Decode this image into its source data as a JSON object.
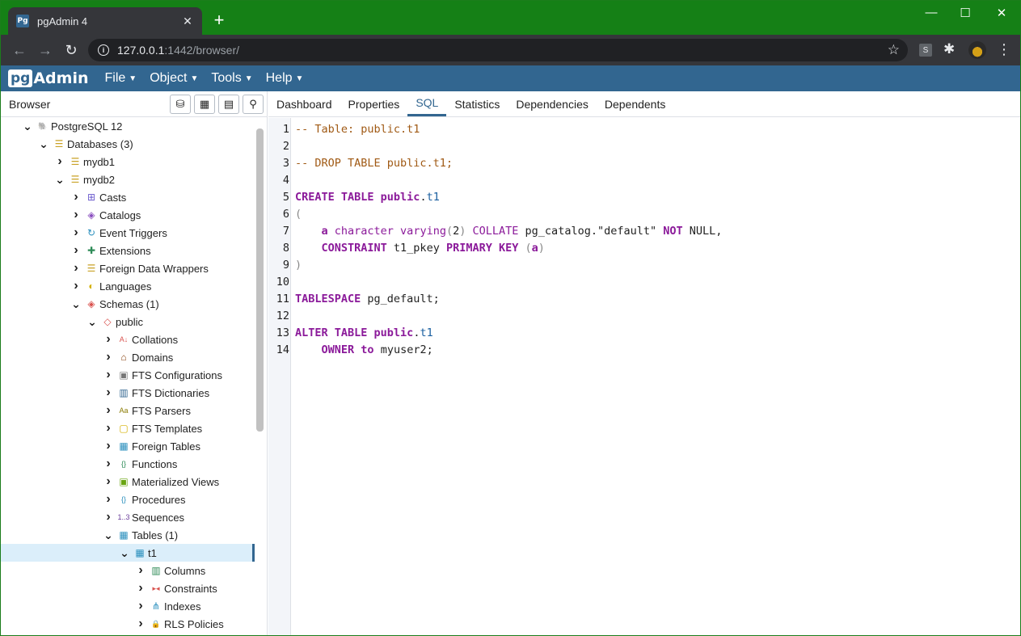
{
  "browser": {
    "tab_title": "pgAdmin 4",
    "tab_favicon": "Pg",
    "url_host": "127.0.0.1",
    "url_path": ":1442/browser/",
    "ext_label": "S"
  },
  "pgadmin": {
    "logo_pg": "pg",
    "logo_admin": "Admin",
    "menu": [
      "File",
      "Object",
      "Tools",
      "Help"
    ]
  },
  "browser_panel": {
    "title": "Browser"
  },
  "tree": [
    {
      "depth": 0,
      "expanded": true,
      "label": "PostgreSQL 12",
      "icon": "server-icon",
      "glyph": "🐘",
      "color": "#326690"
    },
    {
      "depth": 1,
      "expanded": true,
      "label": "Databases (3)",
      "icon": "databases-icon",
      "glyph": "☰",
      "color": "#c9a227"
    },
    {
      "depth": 2,
      "expanded": false,
      "label": "mydb1",
      "icon": "database-icon",
      "glyph": "☰",
      "color": "#c9a227"
    },
    {
      "depth": 2,
      "expanded": true,
      "label": "mydb2",
      "icon": "database-icon",
      "glyph": "☰",
      "color": "#c9a227"
    },
    {
      "depth": 3,
      "expanded": false,
      "label": "Casts",
      "icon": "casts-icon",
      "glyph": "⊞",
      "color": "#6a5acd"
    },
    {
      "depth": 3,
      "expanded": false,
      "label": "Catalogs",
      "icon": "catalogs-icon",
      "glyph": "◈",
      "color": "#8a4fbf"
    },
    {
      "depth": 3,
      "expanded": false,
      "label": "Event Triggers",
      "icon": "event-triggers-icon",
      "glyph": "↻",
      "color": "#2a8fbd"
    },
    {
      "depth": 3,
      "expanded": false,
      "label": "Extensions",
      "icon": "extensions-icon",
      "glyph": "✚",
      "color": "#2e8b57"
    },
    {
      "depth": 3,
      "expanded": false,
      "label": "Foreign Data Wrappers",
      "icon": "fdw-icon",
      "glyph": "☰",
      "color": "#c9a227"
    },
    {
      "depth": 3,
      "expanded": false,
      "label": "Languages",
      "icon": "languages-icon",
      "glyph": "◐",
      "color": "#d4b000"
    },
    {
      "depth": 3,
      "expanded": true,
      "label": "Schemas (1)",
      "icon": "schemas-icon",
      "glyph": "◈",
      "color": "#d9534f"
    },
    {
      "depth": 4,
      "expanded": true,
      "label": "public",
      "icon": "schema-icon",
      "glyph": "◇",
      "color": "#d9534f"
    },
    {
      "depth": 5,
      "expanded": false,
      "label": "Collations",
      "icon": "collations-icon",
      "glyph": "A↓",
      "color": "#d9534f"
    },
    {
      "depth": 5,
      "expanded": false,
      "label": "Domains",
      "icon": "domains-icon",
      "glyph": "⌂",
      "color": "#8b4513"
    },
    {
      "depth": 5,
      "expanded": false,
      "label": "FTS Configurations",
      "icon": "fts-configurations-icon",
      "glyph": "▣",
      "color": "#777"
    },
    {
      "depth": 5,
      "expanded": false,
      "label": "FTS Dictionaries",
      "icon": "fts-dictionaries-icon",
      "glyph": "▥",
      "color": "#336791"
    },
    {
      "depth": 5,
      "expanded": false,
      "label": "FTS Parsers",
      "icon": "fts-parsers-icon",
      "glyph": "Aa",
      "color": "#8a7a00"
    },
    {
      "depth": 5,
      "expanded": false,
      "label": "FTS Templates",
      "icon": "fts-templates-icon",
      "glyph": "▢",
      "color": "#d4b000"
    },
    {
      "depth": 5,
      "expanded": false,
      "label": "Foreign Tables",
      "icon": "foreign-tables-icon",
      "glyph": "▦",
      "color": "#2a8fbd"
    },
    {
      "depth": 5,
      "expanded": false,
      "label": "Functions",
      "icon": "functions-icon",
      "glyph": "{}",
      "color": "#2e8b57"
    },
    {
      "depth": 5,
      "expanded": false,
      "label": "Materialized Views",
      "icon": "materialized-views-icon",
      "glyph": "▣",
      "color": "#6aa512"
    },
    {
      "depth": 5,
      "expanded": false,
      "label": "Procedures",
      "icon": "procedures-icon",
      "glyph": "{}",
      "color": "#2a8fbd"
    },
    {
      "depth": 5,
      "expanded": false,
      "label": "Sequences",
      "icon": "sequences-icon",
      "glyph": "1..3",
      "color": "#6a3d9a"
    },
    {
      "depth": 5,
      "expanded": true,
      "label": "Tables (1)",
      "icon": "tables-icon",
      "glyph": "▦",
      "color": "#2a8fbd"
    },
    {
      "depth": 6,
      "expanded": true,
      "label": "t1",
      "icon": "table-icon",
      "glyph": "▦",
      "color": "#2a8fbd",
      "selected": true
    },
    {
      "depth": 7,
      "expanded": false,
      "label": "Columns",
      "icon": "columns-icon",
      "glyph": "▥",
      "color": "#2e8b57"
    },
    {
      "depth": 7,
      "expanded": false,
      "label": "Constraints",
      "icon": "constraints-icon",
      "glyph": "▸◂",
      "color": "#d9534f"
    },
    {
      "depth": 7,
      "expanded": false,
      "label": "Indexes",
      "icon": "indexes-icon",
      "glyph": "⋔",
      "color": "#2a8fbd"
    },
    {
      "depth": 7,
      "expanded": false,
      "label": "RLS Policies",
      "icon": "rls-policies-icon",
      "glyph": "🔒",
      "color": "#2e8b57"
    }
  ],
  "right_tabs": [
    "Dashboard",
    "Properties",
    "SQL",
    "Statistics",
    "Dependencies",
    "Dependents"
  ],
  "active_tab": "SQL",
  "sql_lines": [
    [
      [
        "cm-comment",
        "-- Table: public.t1"
      ]
    ],
    [],
    [
      [
        "cm-comment",
        "-- DROP TABLE public.t1;"
      ]
    ],
    [],
    [
      [
        "cm-keyword",
        "CREATE TABLE "
      ],
      [
        "cm-keyword",
        "public"
      ],
      [
        "cm-plain",
        "."
      ],
      [
        "cm-def",
        "t1"
      ]
    ],
    [
      [
        "cm-punct",
        "("
      ]
    ],
    [
      [
        "cm-plain",
        "    "
      ],
      [
        "cm-keyword",
        "a "
      ],
      [
        "cm-type",
        "character varying"
      ],
      [
        "cm-punct",
        "("
      ],
      [
        "cm-plain",
        "2"
      ],
      [
        "cm-punct",
        ")"
      ],
      [
        "cm-plain",
        " "
      ],
      [
        "cm-type",
        "COLLATE"
      ],
      [
        "cm-plain",
        " pg_catalog.\"default\" "
      ],
      [
        "cm-keyword",
        "NOT"
      ],
      [
        "cm-plain",
        " NULL,"
      ]
    ],
    [
      [
        "cm-plain",
        "    "
      ],
      [
        "cm-keyword",
        "CONSTRAINT"
      ],
      [
        "cm-plain",
        " t1_pkey "
      ],
      [
        "cm-keyword",
        "PRIMARY KEY"
      ],
      [
        "cm-plain",
        " "
      ],
      [
        "cm-punct",
        "("
      ],
      [
        "cm-keyword",
        "a"
      ],
      [
        "cm-punct",
        ")"
      ]
    ],
    [
      [
        "cm-punct",
        ")"
      ]
    ],
    [],
    [
      [
        "cm-keyword",
        "TABLESPACE"
      ],
      [
        "cm-plain",
        " pg_default;"
      ]
    ],
    [],
    [
      [
        "cm-keyword",
        "ALTER TABLE "
      ],
      [
        "cm-keyword",
        "public"
      ],
      [
        "cm-plain",
        "."
      ],
      [
        "cm-def",
        "t1"
      ]
    ],
    [
      [
        "cm-plain",
        "    "
      ],
      [
        "cm-keyword",
        "OWNER"
      ],
      [
        "cm-plain",
        " "
      ],
      [
        "cm-keyword",
        "to"
      ],
      [
        "cm-plain",
        " myuser2;"
      ]
    ]
  ]
}
